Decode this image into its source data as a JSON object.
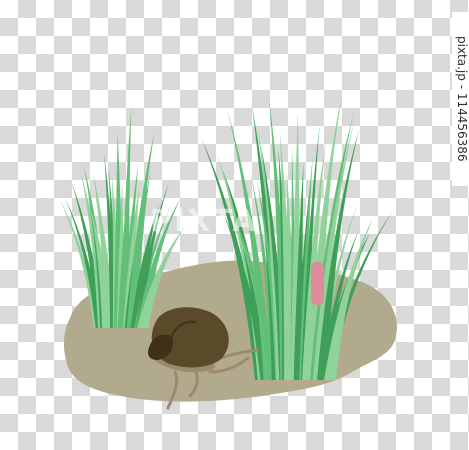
{
  "image": {
    "watermark_text": "PIXTA",
    "side_credit": "pixta.jp - 114456386"
  },
  "colors": {
    "checker_light": "#ffffff",
    "checker_dark": "#d9d9d9",
    "ground": "#b2aa8d",
    "grass_light": "#8fd39a",
    "grass_mid": "#62bf77",
    "grass_dark": "#3f9e57",
    "snail_shell": "#5a4a2a",
    "snail_shell_dark": "#3e3118",
    "snail_body": "#9c8a6e",
    "egg_mass": "#e08a9c"
  }
}
